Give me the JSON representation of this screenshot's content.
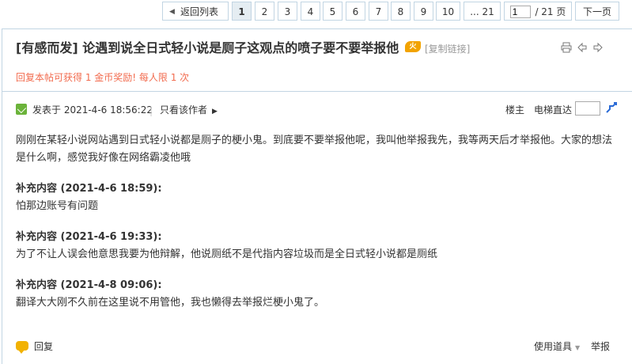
{
  "pager": {
    "back_label": "返回列表",
    "pages": [
      "1",
      "2",
      "3",
      "4",
      "5",
      "6",
      "7",
      "8",
      "9",
      "10"
    ],
    "current": "1",
    "ellipsis_last": "... 21",
    "page_input_value": "1",
    "total_label": "/ 21 页",
    "next_label": "下一页"
  },
  "thread": {
    "title": "[有感而发] 论遇到说全日式轻小说是厕子这观点的喷子要不要举报他",
    "hot_badge": "火",
    "copy_link": "[复制链接]",
    "reward_text": "回复本帖可获得 1 金币奖励! 每人限 1 次"
  },
  "post": {
    "posted_at": "发表于 2021-4-6 18:56:22",
    "divider": "|",
    "only_author": "只看该作者",
    "floor": "楼主",
    "jump_label": "电梯直达",
    "body": "刚刚在某轻小说网站遇到日式轻小说都是厕子的梗小鬼。到底要不要举报他呢，我叫他举报我先，我等两天后才举报他。大家的想法是什么啊，感觉我好像在网络霸凌他哦",
    "supplements": [
      {
        "title": "补充内容 (2021-4-6 18:59):",
        "body": "怕那边账号有问题"
      },
      {
        "title": "补充内容 (2021-4-6 19:33):",
        "body": "为了不让人误会他意思我要为他辩解，他说厕纸不是代指内容垃圾而是全日式轻小说都是厕纸"
      },
      {
        "title": "补充内容 (2021-4-8 09:06):",
        "body": "翻译大大刚不久前在这里说不用管他，我也懒得去举报烂梗小鬼了。"
      }
    ]
  },
  "footer": {
    "reply_label": "回复",
    "tools_label": "使用道具",
    "report_label": "举报"
  },
  "colors": {
    "border": "#c2d5e3",
    "reward": "#f26c4f",
    "current_page_bg": "#e5edf2",
    "hot_badge": "#f2a300"
  }
}
